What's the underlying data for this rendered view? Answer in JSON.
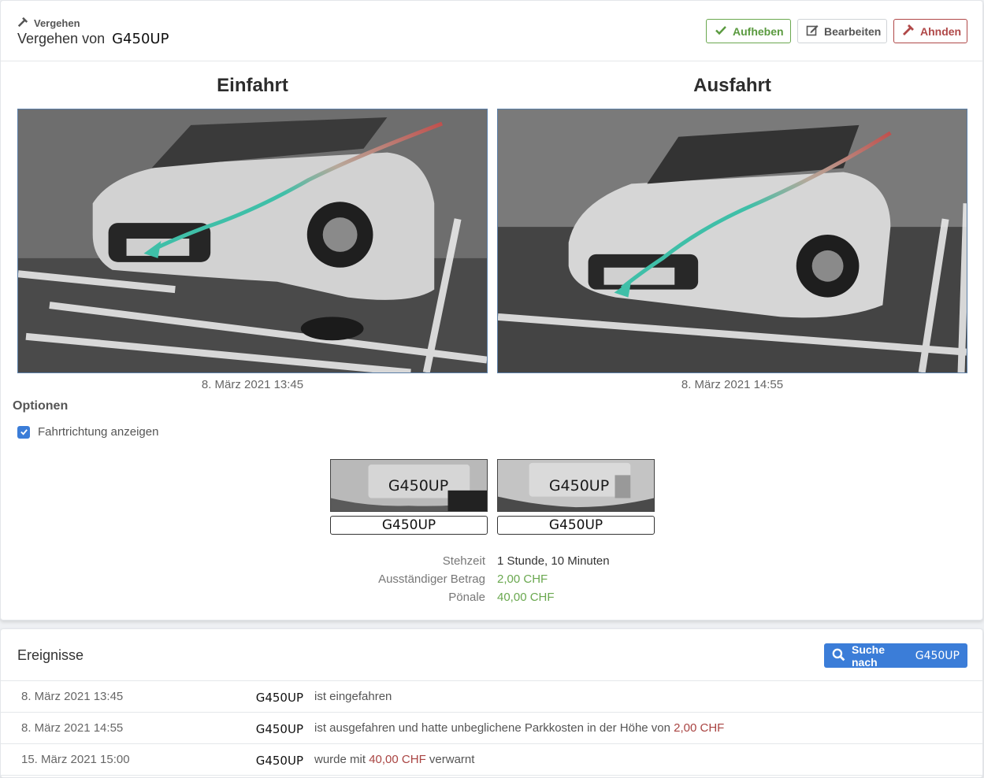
{
  "header": {
    "breadcrumb": "Vergehen",
    "title_prefix": "Vergehen von",
    "title_plate": "G450UP",
    "buttons": {
      "aufheben": "Aufheben",
      "bearbeiten": "Bearbeiten",
      "ahnden": "Ahnden"
    }
  },
  "images": {
    "entry": {
      "title": "Einfahrt",
      "timestamp": "8. März 2021 13:45"
    },
    "exit": {
      "title": "Ausfahrt",
      "timestamp": "8. März 2021 14:55"
    }
  },
  "options": {
    "title": "Optionen",
    "direction_label": "Fahrtrichtung anzeigen",
    "direction_checked": true
  },
  "plates": {
    "entry": {
      "crop_text": "G450UP",
      "recognized": "G450UP"
    },
    "exit": {
      "crop_text": "G450UP",
      "recognized": "G450UP"
    }
  },
  "stats": [
    {
      "label": "Stehzeit",
      "value": "1 Stunde, 10 Minuten"
    },
    {
      "label": "Ausständiger Betrag",
      "value": "2,00 CHF"
    },
    {
      "label": "Pönale",
      "value": "40,00 CHF"
    }
  ],
  "events": {
    "title": "Ereignisse",
    "search_prefix": "Suche nach",
    "search_plate": "G450UP",
    "rows": [
      {
        "date": "8. März 2021 13:45",
        "plate": "G450UP",
        "text": "ist eingefahren",
        "amount": "",
        "suffix": ""
      },
      {
        "date": "8. März 2021 14:55",
        "plate": "G450UP",
        "text": "ist ausgefahren und hatte unbeglichene Parkkosten in der Höhe von",
        "amount": "2,00 CHF",
        "suffix": ""
      },
      {
        "date": "15. März 2021 15:00",
        "plate": "G450UP",
        "text": "wurde mit",
        "amount": "40,00 CHF",
        "suffix": "verwarnt"
      }
    ]
  },
  "colors": {
    "accent": "#3b7dd8",
    "success": "#6aa84f",
    "danger": "#a94442",
    "trail_start": "#c0504d",
    "trail_end": "#3fbfa8"
  }
}
